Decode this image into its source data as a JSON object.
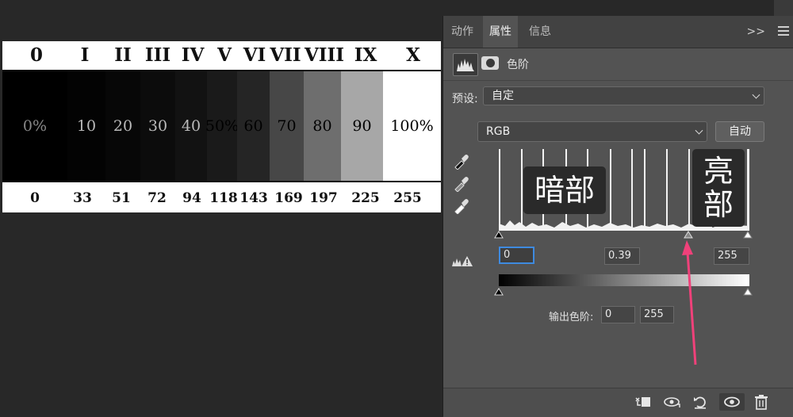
{
  "zone_chart": {
    "roman_labels": [
      "0",
      "I",
      "II",
      "III",
      "IV",
      "V",
      "VI",
      "VII",
      "VIII",
      "IX",
      "X"
    ],
    "percent_labels": [
      "0%",
      "10",
      "20",
      "30",
      "40",
      "50%",
      "60",
      "70",
      "80",
      "90",
      "100%"
    ],
    "values": [
      "0",
      "33",
      "51",
      "72",
      "94",
      "118",
      "143",
      "169",
      "197",
      "225",
      "255"
    ],
    "band_colors": [
      "#000000",
      "#030303",
      "#070707",
      "#0c0c0c",
      "#121212",
      "#1a1a1a",
      "#252525",
      "#474747",
      "#6e6e6e",
      "#a7a7a7",
      "#ffffff"
    ]
  },
  "panel": {
    "tabs": [
      "动作",
      "属性",
      "信息"
    ],
    "active_tab": "属性",
    "collapse_glyph": ">>",
    "adjustment_title": "色阶",
    "preset_label": "预设:",
    "preset_value": "自定",
    "channel_value": "RGB",
    "auto_button": "自动",
    "histogram_labels": {
      "shadows": "暗部",
      "highlights": "亮部"
    },
    "input_levels": {
      "black": "0",
      "gamma": "0.39",
      "white": "255"
    },
    "output_label": "输出色阶:",
    "output_levels": {
      "black": "0",
      "white": "255"
    },
    "accent_color": "#3e8ae0",
    "arrow_color": "#f0417a"
  }
}
